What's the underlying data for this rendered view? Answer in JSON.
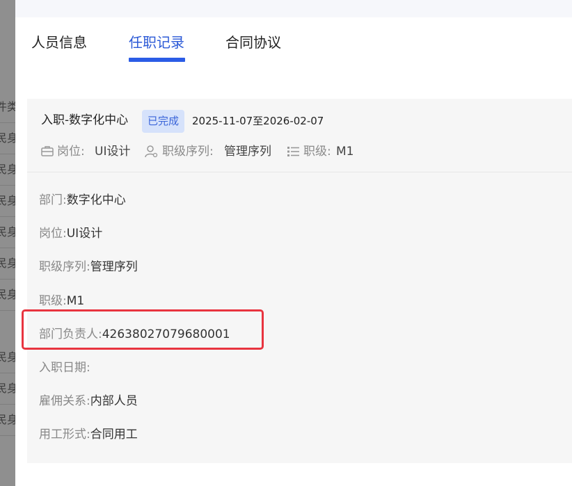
{
  "background_rows": [
    "件类",
    "民身",
    "民身",
    "民身",
    "民身",
    "民身",
    "民身",
    "民身",
    "民身",
    "民身"
  ],
  "tabs": [
    {
      "label": "人员信息"
    },
    {
      "label": "任职记录"
    },
    {
      "label": "合同协议"
    }
  ],
  "active_tab": "任职记录",
  "record": {
    "title": "入职-数字化中心",
    "status": "已完成",
    "date_range": "2025-11-07至2026-02-07",
    "meta": {
      "position_label": "岗位:",
      "position_value": "UI设计",
      "series_label": "职级序列:",
      "series_value": "管理序列",
      "level_label": "职级:",
      "level_value": "M1"
    },
    "fields": [
      {
        "label": "部门:",
        "value": "数字化中心"
      },
      {
        "label": "岗位:",
        "value": "UI设计"
      },
      {
        "label": "职级序列:",
        "value": "管理序列"
      },
      {
        "label": "职级:",
        "value": "M1"
      },
      {
        "label": "部门负责人:",
        "value": "42638027079680001"
      },
      {
        "label": "入职日期:",
        "value": ""
      },
      {
        "label": "雇佣关系:",
        "value": "内部人员"
      },
      {
        "label": "用工形式:",
        "value": "合同用工"
      }
    ]
  },
  "colors": {
    "accent": "#2b5ce6",
    "badge_bg": "#d6e2fb",
    "highlight": "#e8343f"
  }
}
